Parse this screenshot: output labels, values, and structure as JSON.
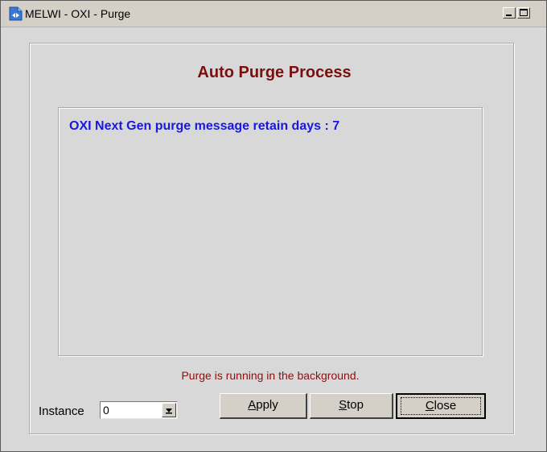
{
  "window": {
    "title": "MELWI - OXI - Purge"
  },
  "panel": {
    "heading": "Auto Purge Process",
    "message": "OXI Next Gen purge message retain days : 7",
    "status": "Purge is running in the background."
  },
  "instance": {
    "label": "Instance",
    "value": "0"
  },
  "buttons": {
    "apply": {
      "mnemonic": "A",
      "rest": "pply"
    },
    "stop": {
      "mnemonic": "S",
      "rest": "top"
    },
    "close": {
      "mnemonic": "C",
      "rest": "lose"
    }
  },
  "colors": {
    "heading": "#7a0f0f",
    "message": "#1818e0",
    "status": "#8a1010",
    "window_bg": "#d8d8d8"
  }
}
